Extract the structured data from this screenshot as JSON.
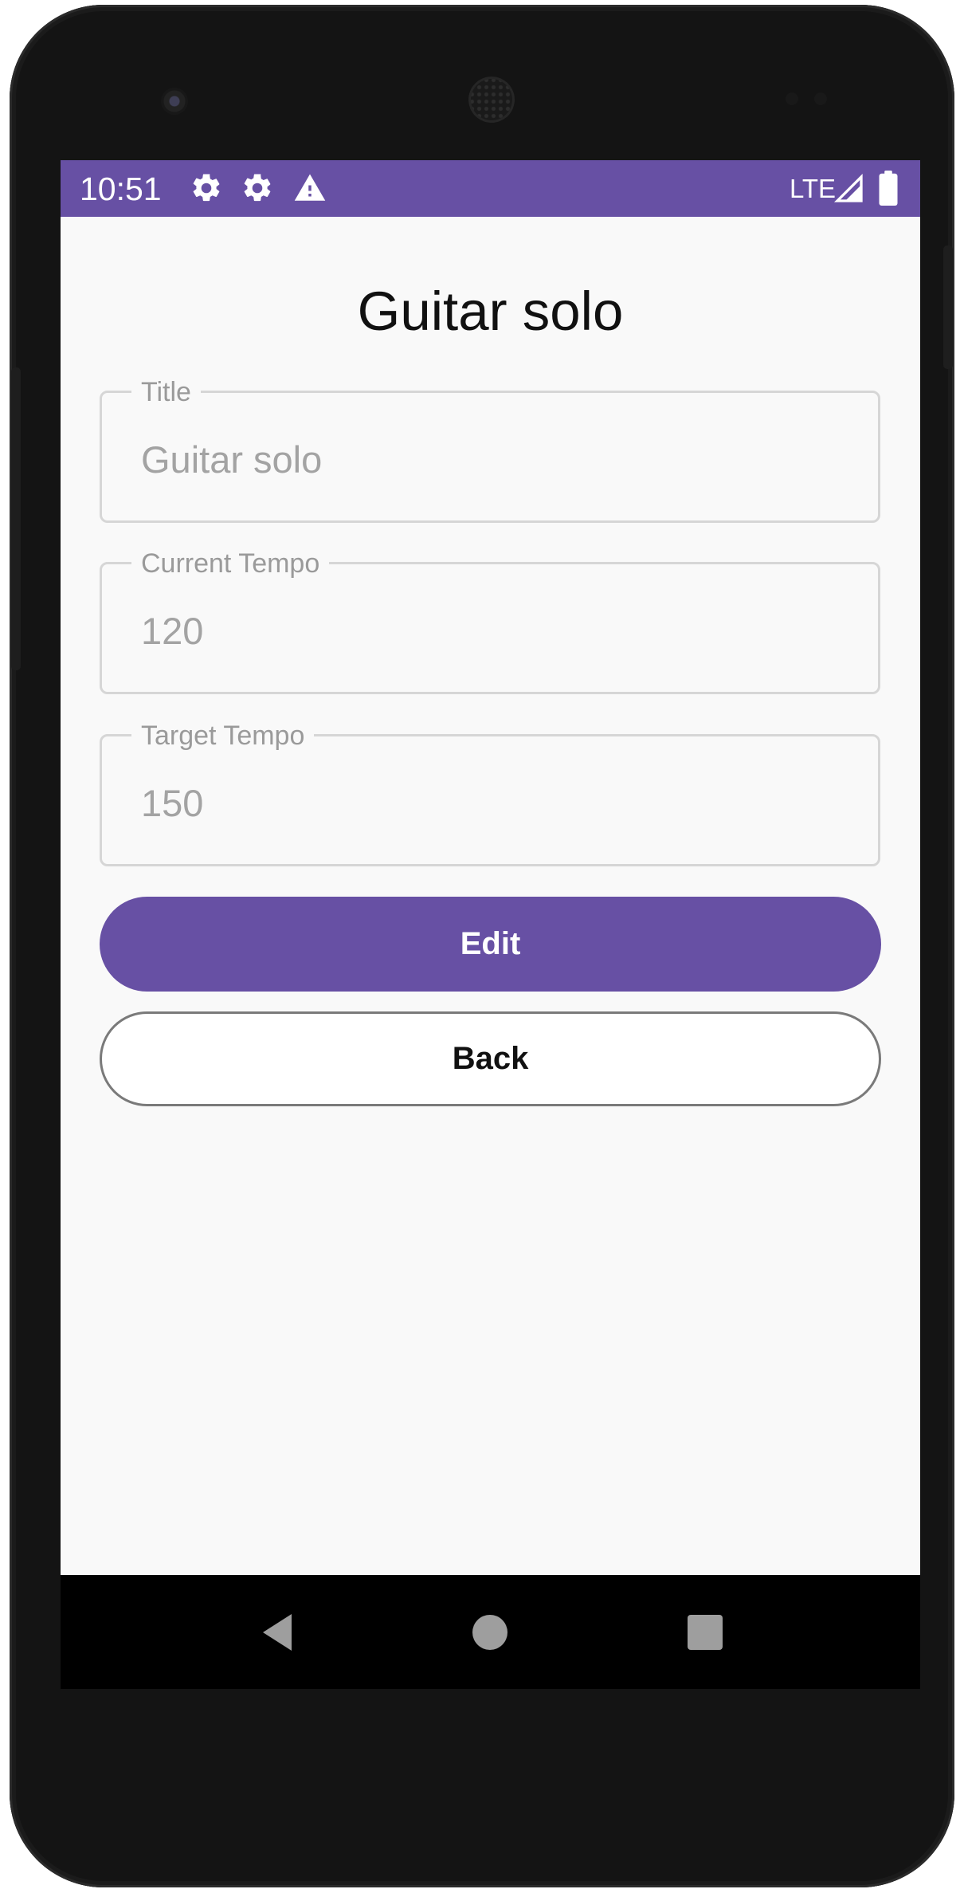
{
  "status_bar": {
    "time": "10:51",
    "network": "LTE",
    "icons": [
      "settings-icon",
      "settings-icon",
      "warning-icon",
      "signal-icon",
      "battery-icon"
    ],
    "background": "#6750a4"
  },
  "page": {
    "title": "Guitar solo"
  },
  "form": {
    "title_field": {
      "label": "Title",
      "value": "Guitar solo"
    },
    "current_tempo_field": {
      "label": "Current Tempo",
      "value": "120"
    },
    "target_tempo_field": {
      "label": "Target Tempo",
      "value": "150"
    }
  },
  "buttons": {
    "edit_label": "Edit",
    "back_label": "Back"
  },
  "navigation": {
    "icons": [
      "back-triangle-icon",
      "home-circle-icon",
      "recents-square-icon"
    ]
  },
  "colors": {
    "accent": "#6750a4",
    "screen_background": "#f9f9f9",
    "field_border": "#d6d6d6",
    "field_text": "#a3a3a3"
  }
}
